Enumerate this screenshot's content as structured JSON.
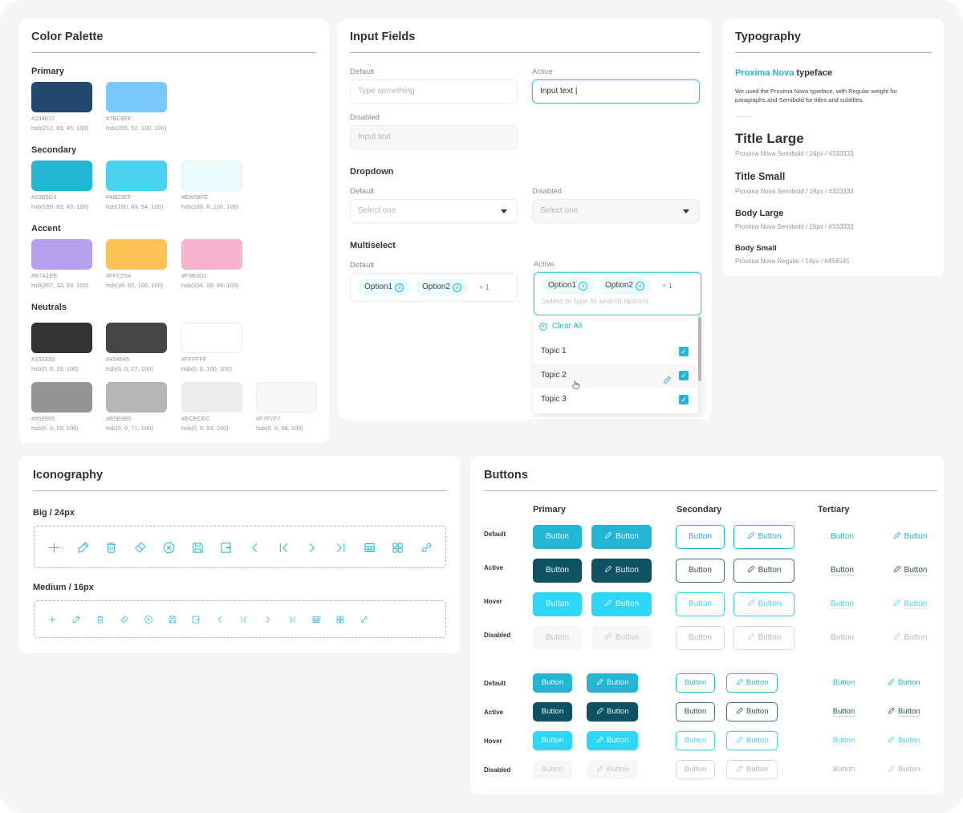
{
  "palette": {
    "title": "Color Palette",
    "groups": {
      "primary": {
        "label": "Primary",
        "swatches": [
          {
            "hex": "#234872",
            "hsb": "hsb(212, 69, 45, 100)"
          },
          {
            "hex": "#7BC8FF",
            "hsb": "hsb(205, 52, 100, 100)"
          }
        ]
      },
      "secondary": {
        "label": "Secondary",
        "swatches": [
          {
            "hex": "#23B5D3",
            "hsb": "hsb(190, 83, 83, 100)"
          },
          {
            "hex": "#48D3EF",
            "hsb": "hsb(190, 83, 94, 100)"
          },
          {
            "hex": "#EAFBFE",
            "hsb": "hsb(189, 8, 100, 100)"
          }
        ]
      },
      "accent": {
        "label": "Accent",
        "swatches": [
          {
            "hex": "#B7A1EE",
            "hsb": "hsb(257, 32, 93, 100)"
          },
          {
            "hex": "#FFC254",
            "hsb": "hsb(39, 62, 100, 100)"
          },
          {
            "hex": "#F9B3D1",
            "hsb": "hsb(334, 28, 98, 100)"
          }
        ]
      },
      "neutrals": {
        "label": "Neutrals",
        "swatches": [
          {
            "hex": "#333333",
            "hsb": "hsb(0, 0, 20, 100)"
          },
          {
            "hex": "#454545",
            "hsb": "hsb(0, 0, 27, 100)"
          },
          {
            "hex": "#FFFFFF",
            "hsb": "hsb(0, 0, 100, 100)"
          },
          {
            "hex": "#959595",
            "hsb": "hsb(0, 0, 59, 100)"
          },
          {
            "hex": "#B5B5B5",
            "hsb": "hsb(0, 0, 71, 100)"
          },
          {
            "hex": "#ECECEC",
            "hsb": "hsb(0, 0, 93, 100)"
          },
          {
            "hex": "#F7F7F7",
            "hsb": "hsb(0, 0, 98, 100)"
          }
        ]
      }
    }
  },
  "inputs": {
    "title": "Input Fields",
    "text": {
      "default_label": "Default",
      "default_placeholder": "Type something",
      "active_label": "Active",
      "active_value": "Input text |",
      "disabled_label": "Disabled",
      "disabled_value": "Input text"
    },
    "dropdown": {
      "title": "Dropdown",
      "default_label": "Default",
      "default_placeholder": "Select one",
      "disabled_label": "Disabled",
      "disabled_placeholder": "Select one"
    },
    "multiselect": {
      "title": "Multiselect",
      "default_label": "Default",
      "active_label": "Active",
      "chips": [
        "Option1",
        "Option2"
      ],
      "more": "+ 1",
      "search_placeholder": "Select or type to search options",
      "clear_all": "Clear All",
      "options": [
        {
          "label": "Topic 1",
          "checked": true
        },
        {
          "label": "Topic 2",
          "checked": true
        },
        {
          "label": "Topic 3",
          "checked": true
        }
      ]
    }
  },
  "typography": {
    "title": "Typography",
    "typeface_name": "Proxima Nova",
    "typeface_suffix": " typeface",
    "description": "We used the Proxima Nova typeface, with Regular weight for paragraphs and Semibold for titles and subtitles.",
    "styles": [
      {
        "name": "Title Large",
        "spec": "Proxima Nova Semibold / 24px / #333333"
      },
      {
        "name": "Title Small",
        "spec": "Proxima Nova Semibold / 18px / #333333"
      },
      {
        "name": "Body Large",
        "spec": "Proxima Nova Semibold / 16px / #333333"
      },
      {
        "name": "Body Small",
        "spec": "Proxima Nova Regular / 14px / #454545"
      }
    ]
  },
  "iconography": {
    "title": "Iconography",
    "big_label": "Big / 24px",
    "medium_label": "Medium / 16px",
    "icons": [
      "plus",
      "pencil",
      "trash",
      "eraser",
      "close-circle",
      "save",
      "export",
      "chevron-left",
      "first-page",
      "chevron-right",
      "last-page",
      "table",
      "grid",
      "link"
    ]
  },
  "buttons": {
    "title": "Buttons",
    "columns": [
      "Primary",
      "Secondary",
      "Tertiary"
    ],
    "states": [
      "Default",
      "Active",
      "Hover",
      "Disabled"
    ],
    "label": "Button"
  },
  "colors": {
    "accent": "#23B5D3",
    "accent_hover": "#48D3EF",
    "accent_active": "#0E5263",
    "background": "#F5F5F5"
  }
}
